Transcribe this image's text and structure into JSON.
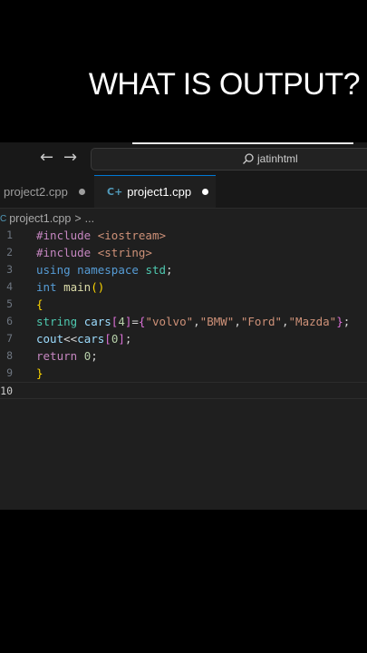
{
  "overlay": {
    "question": "WHAT IS OUTPUT?"
  },
  "titlebar": {
    "back_glyph": "←",
    "forward_glyph": "→",
    "search_text": "jatinhtml",
    "search_icon": "search-icon"
  },
  "tabs": [
    {
      "label": "project2.cpp",
      "active": false,
      "unsaved": true
    },
    {
      "label": "project1.cpp",
      "active": true,
      "unsaved": true,
      "icon": "c++-file-icon"
    }
  ],
  "breadcrumb": {
    "file": "project1.cpp",
    "separator": ">",
    "more": "..."
  },
  "editor": {
    "line_numbers": [
      "1",
      "2",
      "3",
      "4",
      "5",
      "6",
      "7",
      "8",
      "9",
      "10"
    ],
    "lines": [
      [
        {
          "t": "#include",
          "c": "kw-pre"
        },
        {
          "t": " ",
          "c": "plain"
        },
        {
          "t": "<iostream>",
          "c": "inc"
        }
      ],
      [
        {
          "t": "#include",
          "c": "kw-pre"
        },
        {
          "t": " ",
          "c": "plain"
        },
        {
          "t": "<string>",
          "c": "inc"
        }
      ],
      [
        {
          "t": "using",
          "c": "kw"
        },
        {
          "t": " ",
          "c": "plain"
        },
        {
          "t": "namespace",
          "c": "kw"
        },
        {
          "t": " ",
          "c": "plain"
        },
        {
          "t": "std",
          "c": "ns"
        },
        {
          "t": ";",
          "c": "plain"
        }
      ],
      [
        {
          "t": "int",
          "c": "kw"
        },
        {
          "t": " ",
          "c": "plain"
        },
        {
          "t": "main",
          "c": "fn"
        },
        {
          "t": "()",
          "c": "brace1"
        }
      ],
      [
        {
          "t": "{",
          "c": "brace1"
        }
      ],
      [
        {
          "t": "string",
          "c": "typ"
        },
        {
          "t": " ",
          "c": "plain"
        },
        {
          "t": "cars",
          "c": "var"
        },
        {
          "t": "[",
          "c": "brace2"
        },
        {
          "t": "4",
          "c": "num"
        },
        {
          "t": "]",
          "c": "brace2"
        },
        {
          "t": "=",
          "c": "plain"
        },
        {
          "t": "{",
          "c": "brace2"
        },
        {
          "t": "\"volvo\"",
          "c": "str"
        },
        {
          "t": ",",
          "c": "plain"
        },
        {
          "t": "\"BMW\"",
          "c": "str"
        },
        {
          "t": ",",
          "c": "plain"
        },
        {
          "t": "\"Ford\"",
          "c": "str"
        },
        {
          "t": ",",
          "c": "plain"
        },
        {
          "t": "\"Mazda\"",
          "c": "str"
        },
        {
          "t": "}",
          "c": "brace2"
        },
        {
          "t": ";",
          "c": "plain"
        }
      ],
      [
        {
          "t": "cout",
          "c": "var"
        },
        {
          "t": "<<",
          "c": "plain"
        },
        {
          "t": "cars",
          "c": "var"
        },
        {
          "t": "[",
          "c": "brace2"
        },
        {
          "t": "0",
          "c": "num"
        },
        {
          "t": "]",
          "c": "brace2"
        },
        {
          "t": ";",
          "c": "plain"
        }
      ],
      [
        {
          "t": "return",
          "c": "ctl"
        },
        {
          "t": " ",
          "c": "plain"
        },
        {
          "t": "0",
          "c": "num"
        },
        {
          "t": ";",
          "c": "plain"
        }
      ],
      [
        {
          "t": "}",
          "c": "brace1"
        }
      ],
      []
    ],
    "current_line": 10
  },
  "colors": {
    "editor_bg": "#1f1f1f",
    "titlebar_bg": "#181818",
    "active_tab_border": "#0078d4",
    "keyword": "#569cd6",
    "preprocessor": "#c586c0",
    "string": "#ce9178",
    "type": "#4ec9b0"
  }
}
